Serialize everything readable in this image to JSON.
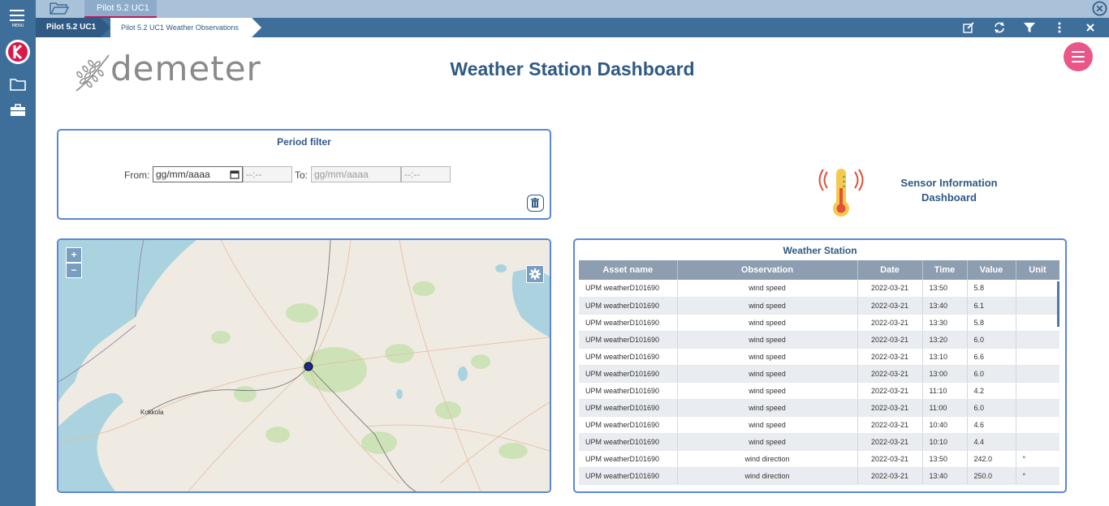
{
  "sidebar": {
    "menu_label": "MENU",
    "brand_color": "#d7194b",
    "icons": [
      "logo-icon",
      "folder-icon",
      "briefcase-icon"
    ]
  },
  "top_tab": "Pilot 5.2 UC1",
  "breadcrumb": [
    "Pilot 5.2 UC1",
    "Pilot 5.2 UC1 Weather Observations"
  ],
  "logo_text": "demeter",
  "page_title": "Weather Station Dashboard",
  "period_filter": {
    "title": "Period filter",
    "from_label": "From:",
    "to_label": "To:",
    "date_placeholder": "gg/mm/aaaa",
    "time_placeholder": "--:--"
  },
  "sensor_info": {
    "line1": "Sensor Information",
    "line2": "Dashboard"
  },
  "map": {
    "zoom_in": "+",
    "zoom_out": "−",
    "city": "Kokkola"
  },
  "weather_station": {
    "title": "Weather Station",
    "columns": [
      "Asset name",
      "Observation",
      "Date",
      "Time",
      "Value",
      "Unit"
    ],
    "rows": [
      [
        "UPM weatherD101690",
        "wind speed",
        "2022-03-21",
        "13:50",
        "5.8",
        ""
      ],
      [
        "UPM weatherD101690",
        "wind speed",
        "2022-03-21",
        "13:40",
        "6.1",
        ""
      ],
      [
        "UPM weatherD101690",
        "wind speed",
        "2022-03-21",
        "13:30",
        "5.8",
        ""
      ],
      [
        "UPM weatherD101690",
        "wind speed",
        "2022-03-21",
        "13:20",
        "6.0",
        ""
      ],
      [
        "UPM weatherD101690",
        "wind speed",
        "2022-03-21",
        "13:10",
        "6.6",
        ""
      ],
      [
        "UPM weatherD101690",
        "wind speed",
        "2022-03-21",
        "13:00",
        "6.0",
        ""
      ],
      [
        "UPM weatherD101690",
        "wind speed",
        "2022-03-21",
        "11:10",
        "4.2",
        ""
      ],
      [
        "UPM weatherD101690",
        "wind speed",
        "2022-03-21",
        "11:00",
        "6.0",
        ""
      ],
      [
        "UPM weatherD101690",
        "wind speed",
        "2022-03-21",
        "10:40",
        "4.6",
        ""
      ],
      [
        "UPM weatherD101690",
        "wind speed",
        "2022-03-21",
        "10:10",
        "4.4",
        ""
      ],
      [
        "UPM weatherD101690",
        "wind direction",
        "2022-03-21",
        "13:50",
        "242.0",
        "°"
      ],
      [
        "UPM weatherD101690",
        "wind direction",
        "2022-03-21",
        "13:40",
        "250.0",
        "°"
      ]
    ]
  }
}
